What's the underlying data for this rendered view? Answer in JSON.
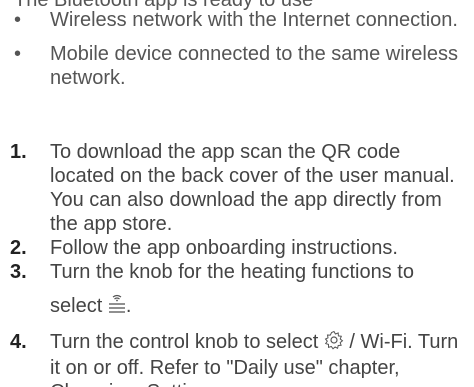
{
  "top_cut_text": "The Bluetooth app is ready to use",
  "bullets": [
    {
      "marker": "•",
      "text": "Wireless network with the Internet connection."
    },
    {
      "marker": "•",
      "text": "Mobile device connected to the same wireless network."
    }
  ],
  "steps": [
    {
      "number": "1.",
      "text": "To download the app scan the QR code located on the back cover of the user manual. You can also download the app directly from the app store."
    },
    {
      "number": "2.",
      "text": "Follow the app onboarding instructions."
    },
    {
      "number": "3.",
      "text_before_break": "Turn the knob for the heating functions to",
      "text_select": "select",
      "icon": "wifi-heating-function-icon",
      "text_after_icon": "."
    },
    {
      "number": "4.",
      "text_before_icon": "Turn the control knob to select",
      "icon": "settings-gear-icon",
      "text_after_icon": " / Wi-Fi. Turn it on or off. Refer to \"Daily use\" chapter, Changing: Settings."
    }
  ]
}
